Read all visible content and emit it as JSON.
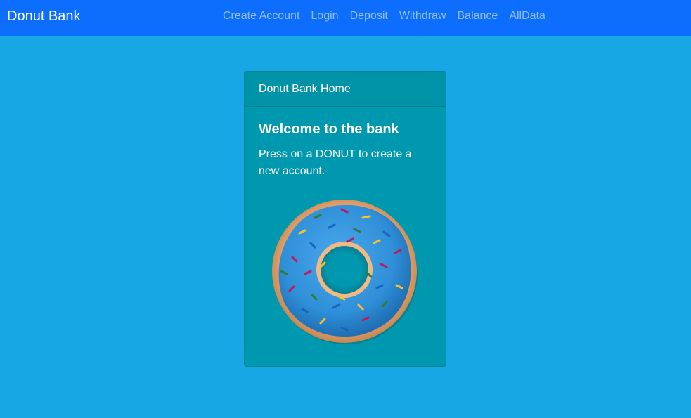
{
  "navbar": {
    "brand": "Donut Bank",
    "links": [
      {
        "label": "Create Account"
      },
      {
        "label": "Login"
      },
      {
        "label": "Deposit"
      },
      {
        "label": "Withdraw"
      },
      {
        "label": "Balance"
      },
      {
        "label": "AllData"
      }
    ]
  },
  "card": {
    "header": "Donut Bank Home",
    "title": "Welcome to the bank",
    "text": "Press on a DONUT to create a new account.",
    "image_icon": "donut-icon"
  },
  "colors": {
    "page_background": "#16a7e4",
    "navbar_background": "#0d6efd",
    "card_background": "#0098ae",
    "icing": "#2f8fd8",
    "dough": "#e0a16a"
  }
}
